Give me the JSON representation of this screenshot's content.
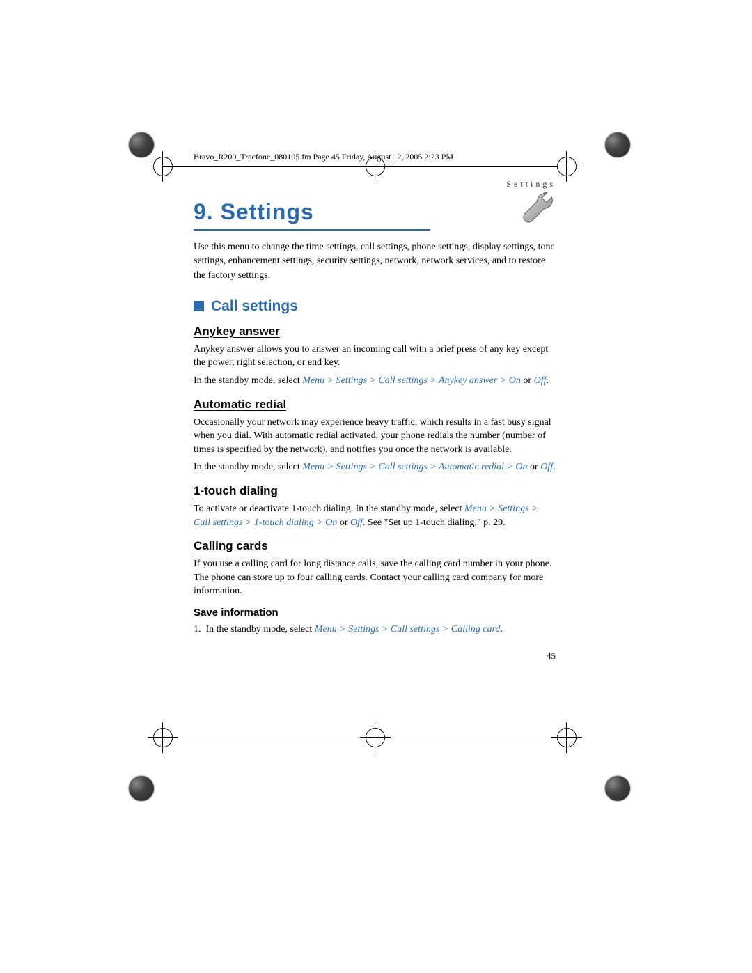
{
  "doc_header": "Bravo_R200_Tracfone_080105.fm  Page 45  Friday, August 12, 2005  2:23 PM",
  "running_head": "Settings",
  "chapter_number": "9.",
  "chapter_title": "Settings",
  "intro": "Use this menu to change the time settings, call settings, phone settings, display settings, tone settings, enhancement settings, security settings, network, network services, and to restore the factory settings.",
  "h2_call": "Call settings",
  "anykey": {
    "title": "Anykey answer",
    "body": "Anykey answer allows you to answer an incoming call with a brief press of any key except the power, right selection, or end key.",
    "lead": "In the standby mode, select ",
    "path": "Menu > Settings > Call settings > Anykey answer > On",
    "or": " or ",
    "off": "Off",
    "end": "."
  },
  "autoredial": {
    "title": "Automatic redial",
    "body": "Occasionally your network may experience heavy traffic, which results in a fast busy signal when you dial. With automatic redial activated, your phone redials the number (number of times is specified by the network), and notifies you once the network is available.",
    "lead": "In the standby mode, select ",
    "path": "Menu > Settings > Call settings > Automatic redial > On",
    "or": " or ",
    "off": "Off",
    "end": "."
  },
  "onetouch": {
    "title": "1-touch dialing",
    "lead": "To activate or deactivate 1-touch dialing. In the standby mode, select ",
    "path": "Menu > Settings > Call settings > 1-touch dialing > On",
    "or": " or ",
    "off": "Off",
    "tail": ". See \"Set up 1-touch dialing,\" p. 29."
  },
  "callingcards": {
    "title": "Calling cards",
    "body": "If you use a calling card for long distance calls, save the calling card number in your phone. The phone can store up to four calling cards. Contact your calling card company for more information."
  },
  "saveinfo": {
    "title": "Save information",
    "num": "1.",
    "lead": "In the standby mode, select ",
    "path": "Menu > Settings > Call settings > Calling card",
    "end": "."
  },
  "page_number": "45"
}
